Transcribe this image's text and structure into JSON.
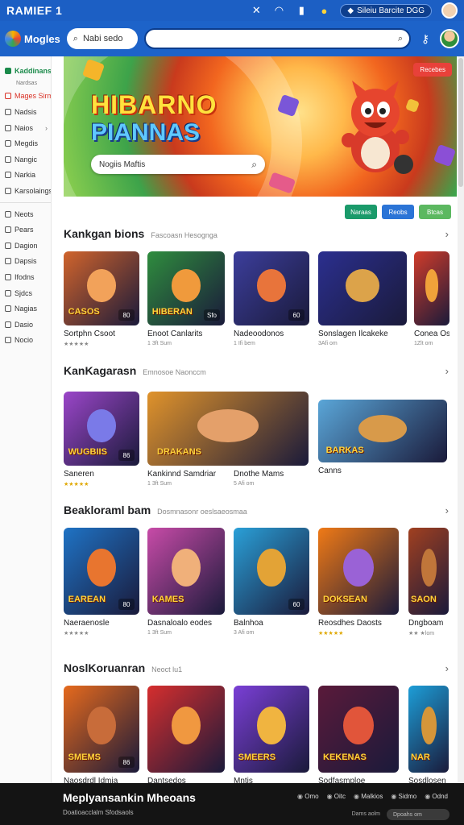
{
  "statusbar": {
    "title": "RAMIEF 1",
    "pill_text": "Sileiu Barcite DGG"
  },
  "appbar": {
    "app_name": "Mogles",
    "search_small": "Nabi sedo",
    "search_big": ""
  },
  "sidebar": {
    "items": [
      {
        "label": "Kaddinans",
        "state": "active"
      },
      {
        "label": "Nardsas",
        "state": "sub"
      },
      {
        "label": "Mages Sirmo",
        "state": "red"
      },
      {
        "label": "Nadsis",
        "state": ""
      },
      {
        "label": "Naios",
        "state": "chev"
      },
      {
        "label": "Megdis",
        "state": ""
      },
      {
        "label": "Nangic",
        "state": ""
      },
      {
        "label": "Narkia",
        "state": ""
      },
      {
        "label": "Karsolaings",
        "state": ""
      },
      {
        "label": "Neots",
        "state": ""
      },
      {
        "label": "Pears",
        "state": ""
      },
      {
        "label": "Dagion",
        "state": ""
      },
      {
        "label": "Dapsis",
        "state": ""
      },
      {
        "label": "Ifodns",
        "state": ""
      },
      {
        "label": "Sjdcs",
        "state": ""
      },
      {
        "label": "Nagias",
        "state": ""
      },
      {
        "label": "Dasio",
        "state": ""
      },
      {
        "label": "Nocio",
        "state": ""
      }
    ]
  },
  "hero": {
    "title_line1": "HIBARNO",
    "title_line2": "PIANNAS",
    "search_placeholder": "Nogiis Maftis",
    "badge": "Recebes"
  },
  "chips": [
    {
      "label": "Naraas",
      "color": "#1a9a6a"
    },
    {
      "label": "Reobs",
      "color": "#2b74d6"
    },
    {
      "label": "Btcas",
      "color": "#5cb860"
    }
  ],
  "sections": [
    {
      "title": "Kankgan bions",
      "subtitle": "Fascoasn Hesognga",
      "cards": [
        {
          "name": "Sortphn Csoot",
          "meta": "★★★★★",
          "tag": "80",
          "text": "CASOS",
          "bg": "#d1642c",
          "face": "#f2a25a",
          "gold": false
        },
        {
          "name": "Enoot Canlarits",
          "meta": "1 3ft Sum",
          "tag": "Sfo",
          "text": "HIBERAN",
          "bg": "#2f8d3e",
          "face": "#f09a3c",
          "gold": false
        },
        {
          "name": "Nadeoodonos",
          "meta": "1 Ifi bem",
          "tag": "60",
          "text": "",
          "bg": "#3c3e9c",
          "face": "#e8743b",
          "gold": false
        },
        {
          "name": "Sonslagen Ilcakeke",
          "meta": "3Afi om",
          "tag": "",
          "text": "",
          "bg": "#2b2f8f",
          "face": "#dca34a",
          "gold": false
        },
        {
          "name": "Conea Os",
          "meta": "1Zlt om",
          "tag": "",
          "text": "",
          "bg": "#d13c2a",
          "face": "#f0a23a",
          "gold": false
        }
      ]
    },
    {
      "title": "KanKagarasn",
      "subtitle": "Emnosoe Naonccm",
      "cards": [
        {
          "name": "Saneren",
          "meta": "★★★★★",
          "tag": "86",
          "text": "WUGBIIS",
          "bg": "#9b46c9",
          "face": "#7a7ae8",
          "gold": true
        },
        {
          "name": "Kankinnd Samdriar",
          "meta": "1 3ft Sum",
          "tag": "",
          "text": "DRAKANS",
          "bg": "#e0932b",
          "face": "#e4a06a",
          "gold": false
        },
        {
          "name": "Dnothe Mams",
          "meta": "5 Afi om",
          "tag": "76",
          "text": "",
          "bg": "#d9b21f",
          "face": "#d24a3a",
          "gold": false
        },
        {
          "name": "Canns",
          "meta": "",
          "tag": "",
          "text": "BARKAS",
          "bg": "#5aa6d8",
          "face": "#d89a4a",
          "gold": false
        }
      ]
    },
    {
      "title": "Beakloraml bam",
      "subtitle": "Dosmnasonr oeslsaeosmaa",
      "cards": [
        {
          "name": "Naeraenosle",
          "meta": "★★★★★",
          "tag": "80",
          "text": "EAREAN",
          "bg": "#1f73c5",
          "face": "#e8752f",
          "gold": false
        },
        {
          "name": "Dasnaloalo eodes",
          "meta": "1 3ft Sum",
          "tag": "",
          "text": "KAMES",
          "bg": "#c84ba8",
          "face": "#f0b07a",
          "gold": false
        },
        {
          "name": "Balnhoa",
          "meta": "3 Afi om",
          "tag": "60",
          "text": "",
          "bg": "#2aa0d8",
          "face": "#e3a336",
          "gold": false
        },
        {
          "name": "Reosdhes Daosts",
          "meta": "★★★★★",
          "tag": "",
          "text": "DOKSEAN",
          "bg": "#f07a16",
          "face": "#9a62d6",
          "gold": true
        },
        {
          "name": "Dngboam",
          "meta": "★★ ★lom",
          "tag": "",
          "text": "SAON",
          "bg": "#a14020",
          "face": "#c0763a",
          "gold": false
        }
      ]
    },
    {
      "title": "NoslKoruanran",
      "subtitle": "Neoct lu1",
      "cards": [
        {
          "name": "Naosdrdl Idmia",
          "meta": "",
          "tag": "86",
          "text": "SMEMS",
          "bg": "#e66a1d",
          "face": "#c86c3a",
          "gold": false
        },
        {
          "name": "Dantsedos",
          "meta": "",
          "tag": "",
          "text": "",
          "bg": "#d62e2e",
          "face": "#f09840",
          "gold": false
        },
        {
          "name": "Mntis",
          "meta": "",
          "tag": "",
          "text": "SMEERS",
          "bg": "#7a3fd6",
          "face": "#f0b440",
          "gold": false
        },
        {
          "name": "Sodfasmploe",
          "meta": "",
          "tag": "",
          "text": "KEKENAS",
          "bg": "#5a1a3a",
          "face": "#e1553a",
          "gold": false
        },
        {
          "name": "Sosdlosen",
          "meta": "",
          "tag": "",
          "text": "NAR",
          "bg": "#1d9ed8",
          "face": "#d5963a",
          "gold": false
        }
      ]
    }
  ],
  "bottombar": {
    "title": "Meplyansankin Mheoans",
    "subtitle": "Doatioacclalm   Sfodsaols",
    "links": [
      "Omo",
      "Oitc",
      "Malkios",
      "Sidmo",
      "Odnd"
    ],
    "label": "Dams aolm",
    "search": "Dpoahs om"
  }
}
